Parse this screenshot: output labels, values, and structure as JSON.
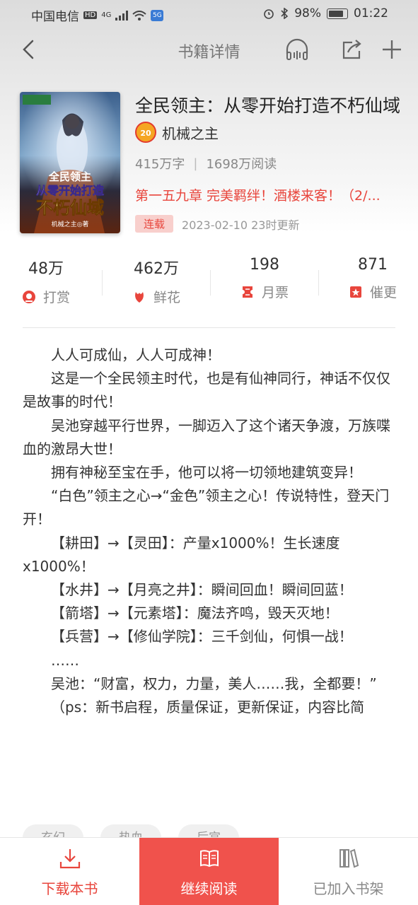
{
  "status_bar": {
    "carrier": "中国电信",
    "hd": "HD",
    "network": "4G",
    "battery": "98%",
    "time": "01:22"
  },
  "nav": {
    "title": "书籍详情"
  },
  "book": {
    "title": "全民领主：从零开始打造不朽仙域",
    "author": "机械之主",
    "author_level": "20",
    "word_count": "415万字",
    "reads": "1698万阅读",
    "latest_chapter": "第一五九章 完美羁绊！酒楼来客！（2/...",
    "serial_status": "连载",
    "update_time": "2023-02-10 23时更新",
    "cover_text": {
      "line1": "全民领主",
      "line2": "从零开始打造",
      "line3": "不朽仙域",
      "author": "机械之主◎著"
    }
  },
  "stats": [
    {
      "value": "48万",
      "label": "打赏",
      "icon": "reward-icon"
    },
    {
      "value": "462万",
      "label": "鲜花",
      "icon": "flower-icon"
    },
    {
      "value": "198",
      "label": "月票",
      "icon": "ticket-icon"
    },
    {
      "value": "871",
      "label": "催更",
      "icon": "urge-icon"
    }
  ],
  "synopsis": [
    "人人可成仙，人人可成神！",
    "这是一个全民领主时代，也是有仙神同行，神话不仅仅是故事的时代！",
    "吴池穿越平行世界，一脚迈入了这个诸天争渡，万族喋血的激昂大世！",
    "拥有神秘至宝在手，他可以将一切领地建筑变异！",
    "“白色”领主之心→“金色”领主之心！传说特性，登天门开！",
    "【耕田】→【灵田】：产量x1000%！生长速度x1000%！",
    "【水井】→【月亮之井】：瞬间回血！瞬间回蓝！",
    "【箭塔】→【元素塔】：魔法齐鸣，毁天灭地！",
    "【兵营】→【修仙学院】：三千剑仙，何惧一战！",
    "……",
    "吴池：“财富，权力，力量，美人……我，全都要！”",
    "（ps：新书启程，质量保证，更新保证，内容比简"
  ],
  "tags": [
    "玄幻",
    "热血",
    "后宫"
  ],
  "bottom_bar": {
    "download": "下载本书",
    "continue": "继续阅读",
    "shelf": "已加入书架"
  },
  "colors": {
    "accent": "#e8453c",
    "continue_bg": "#f0524c"
  }
}
